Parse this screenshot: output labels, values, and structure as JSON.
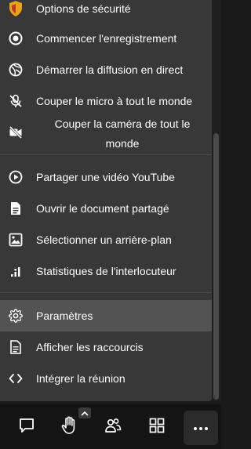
{
  "menu": {
    "items": [
      {
        "label": "Options de sécurité",
        "icon": "shield-icon"
      },
      {
        "label": "Commencer l'enregistrement",
        "icon": "record-icon"
      },
      {
        "label": "Démarrer la diffusion en direct",
        "icon": "livestream-icon"
      },
      {
        "label": "Couper le micro à tout le monde",
        "icon": "mic-off-icon"
      },
      {
        "label_line1": "Couper la caméra de tout le",
        "label_line2": "monde",
        "icon": "camera-off-icon"
      },
      {
        "label": "Partager une vidéo YouTube",
        "icon": "play-circle-icon"
      },
      {
        "label": "Ouvrir le document partagé",
        "icon": "document-icon"
      },
      {
        "label": "Sélectionner un arrière-plan",
        "icon": "image-icon"
      },
      {
        "label": "Statistiques de l'interlocuteur",
        "icon": "stats-icon"
      },
      {
        "label": "Paramètres",
        "icon": "gear-icon"
      },
      {
        "label": "Afficher les raccourcis",
        "icon": "shortcuts-icon"
      },
      {
        "label": "Intégrer la réunion",
        "icon": "embed-icon"
      }
    ]
  },
  "toolbar": {
    "buttons": [
      "chat-icon",
      "raise-hand-icon",
      "participants-icon",
      "tile-view-icon",
      "more-icon"
    ]
  },
  "colors": {
    "menu_bg": "#383838",
    "hover_bg": "#535353",
    "toolbar_bg": "#141414",
    "shield_accent": "#e8a317"
  }
}
